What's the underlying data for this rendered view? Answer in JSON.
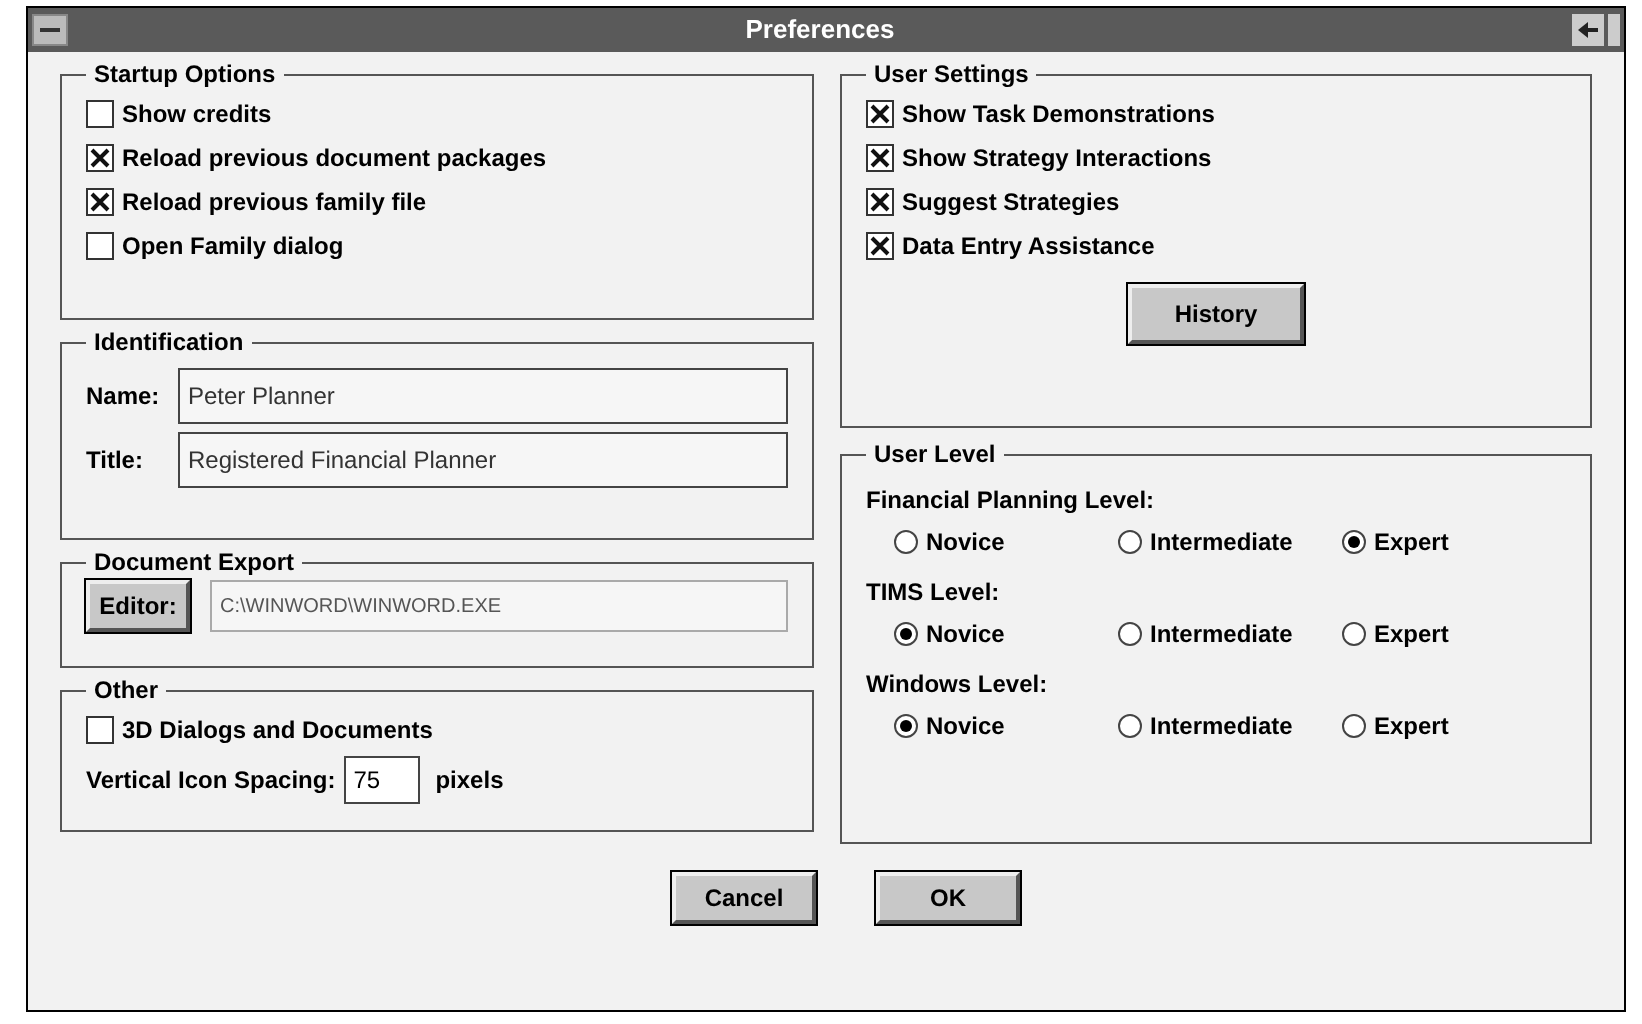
{
  "window": {
    "title": "Preferences"
  },
  "startup_options": {
    "title": "Startup Options",
    "items": [
      {
        "label": "Show credits",
        "checked": false
      },
      {
        "label": "Reload previous document packages",
        "checked": true
      },
      {
        "label": "Reload previous family file",
        "checked": true
      },
      {
        "label": "Open Family dialog",
        "checked": false
      }
    ]
  },
  "identification": {
    "title": "Identification",
    "fields": [
      {
        "label": "Name:",
        "value": "Peter Planner"
      },
      {
        "label": "Title:",
        "value": "Registered Financial Planner"
      }
    ]
  },
  "document_export": {
    "title": "Document Export",
    "button": "Editor:",
    "path": "C:\\WINWORD\\WINWORD.EXE"
  },
  "other": {
    "title": "Other",
    "checkbox": {
      "label": "3D Dialogs and Documents",
      "checked": false
    },
    "spacing_label": "Vertical Icon Spacing:",
    "spacing_value": "75",
    "spacing_unit": "pixels"
  },
  "user_settings": {
    "title": "User Settings",
    "items": [
      {
        "label": "Show Task Demonstrations",
        "checked": true
      },
      {
        "label": "Show Strategy Interactions",
        "checked": true
      },
      {
        "label": "Suggest Strategies",
        "checked": true
      },
      {
        "label": "Data Entry Assistance",
        "checked": true
      }
    ],
    "button": "History"
  },
  "user_level": {
    "title": "User Level",
    "groups": [
      {
        "label": "Financial Planning Level:",
        "options": [
          {
            "label": "Novice",
            "selected": false
          },
          {
            "label": "Intermediate",
            "selected": false
          },
          {
            "label": "Expert",
            "selected": true
          }
        ]
      },
      {
        "label": "TIMS Level:",
        "options": [
          {
            "label": "Novice",
            "selected": true
          },
          {
            "label": "Intermediate",
            "selected": false
          },
          {
            "label": "Expert",
            "selected": false
          }
        ]
      },
      {
        "label": "Windows Level:",
        "options": [
          {
            "label": "Novice",
            "selected": true
          },
          {
            "label": "Intermediate",
            "selected": false
          },
          {
            "label": "Expert",
            "selected": false
          }
        ]
      }
    ]
  },
  "buttons": [
    "Cancel",
    "OK"
  ]
}
